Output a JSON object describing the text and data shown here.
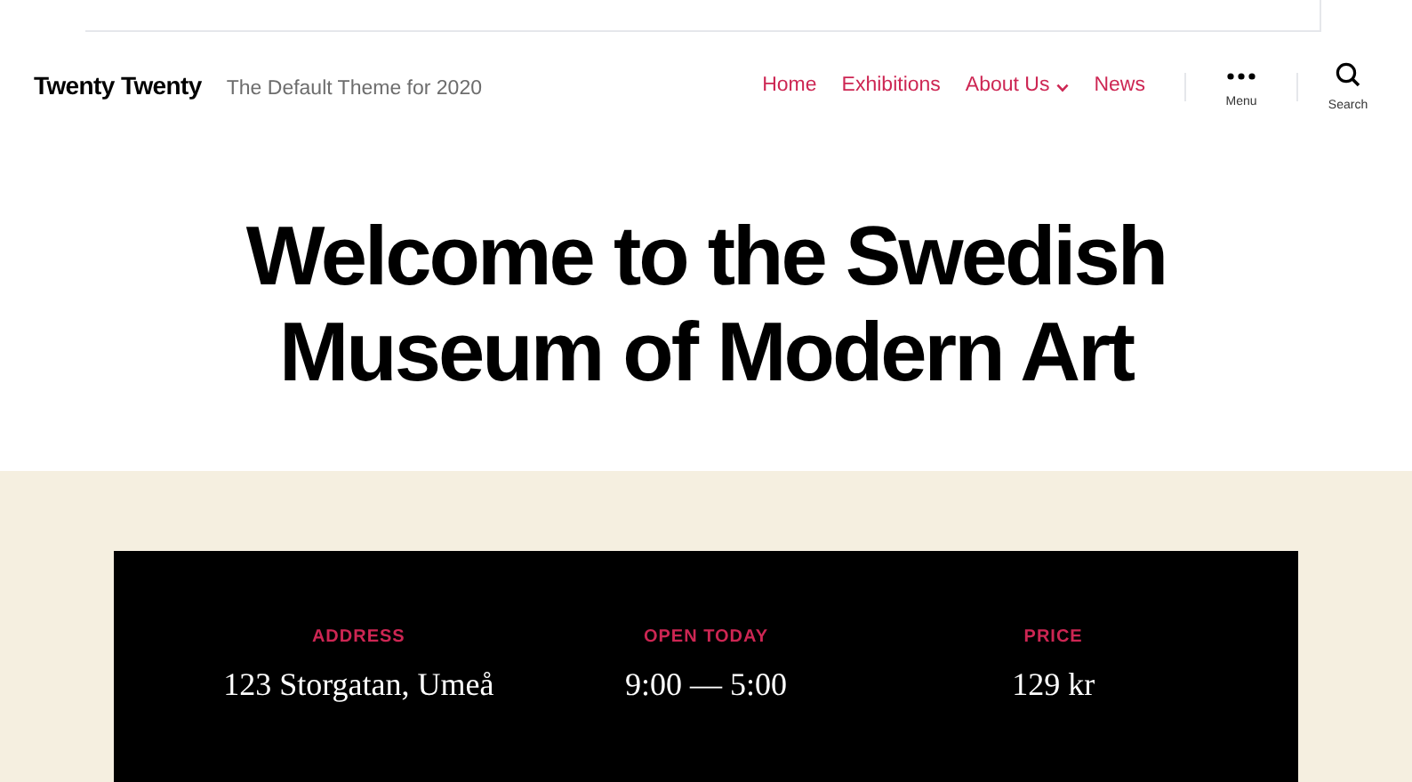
{
  "header": {
    "site_title": "Twenty Twenty",
    "tagline": "The Default Theme for 2020",
    "nav": [
      {
        "label": "Home",
        "has_submenu": false
      },
      {
        "label": "Exhibitions",
        "has_submenu": false
      },
      {
        "label": "About Us",
        "has_submenu": true
      },
      {
        "label": "News",
        "has_submenu": false
      }
    ],
    "menu_toggle": {
      "label": "Menu"
    },
    "search_toggle": {
      "label": "Search"
    }
  },
  "hero": {
    "title": "Welcome to the Swedish Museum of Modern Art"
  },
  "info": [
    {
      "heading": "ADDRESS",
      "value": "123 Storgatan, Umeå"
    },
    {
      "heading": "OPEN TODAY",
      "value": "9:00 — 5:00"
    },
    {
      "heading": "PRICE",
      "value": "129 kr"
    }
  ]
}
